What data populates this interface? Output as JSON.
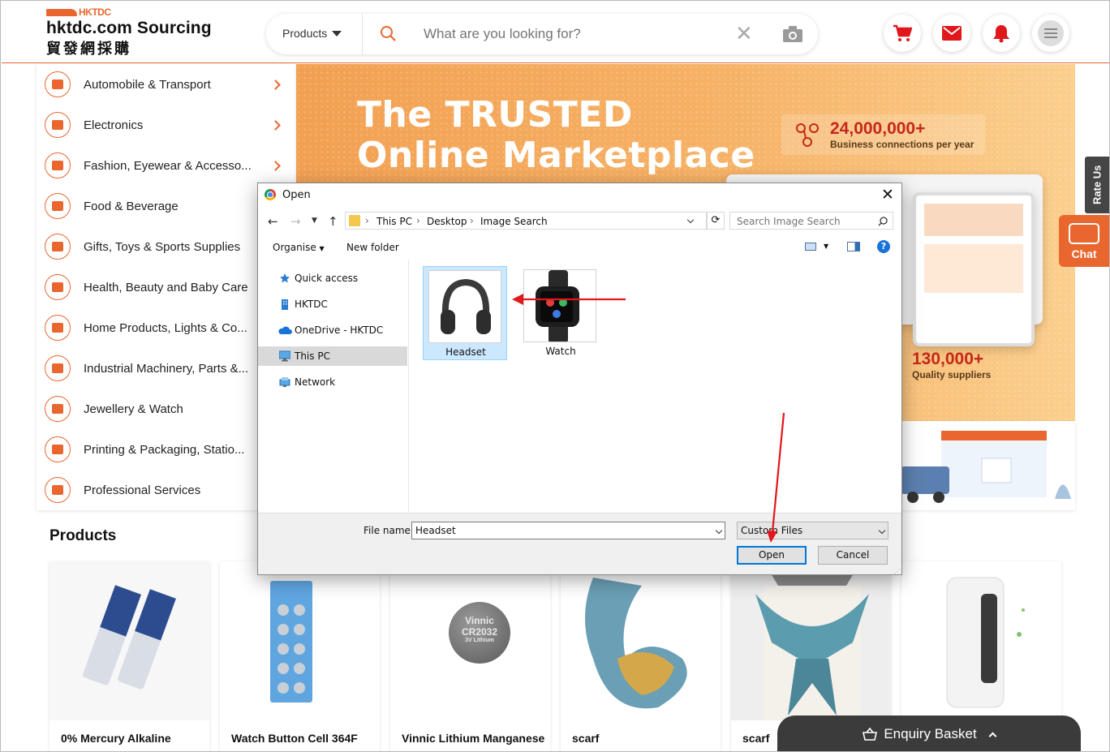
{
  "header": {
    "logo_top": "HKTDC",
    "logo_main": "hktdc.com Sourcing",
    "logo_cn": "貿發網採購",
    "search_category": "Products",
    "search_placeholder": "What are you looking for?",
    "icons": [
      "cart-icon",
      "mail-icon",
      "bell-icon",
      "menu-icon"
    ]
  },
  "sidebar": {
    "items": [
      {
        "label": "Automobile & Transport",
        "chevron": true
      },
      {
        "label": "Electronics",
        "chevron": true
      },
      {
        "label": "Fashion, Eyewear & Accesso...",
        "chevron": true
      },
      {
        "label": "Food & Beverage",
        "chevron": false
      },
      {
        "label": "Gifts, Toys & Sports Supplies",
        "chevron": false
      },
      {
        "label": "Health, Beauty and Baby Care",
        "chevron": false
      },
      {
        "label": "Home Products, Lights & Co...",
        "chevron": false
      },
      {
        "label": "Industrial Machinery, Parts &...",
        "chevron": false
      },
      {
        "label": "Jewellery & Watch",
        "chevron": false
      },
      {
        "label": "Printing & Packaging, Statio...",
        "chevron": false
      },
      {
        "label": "Professional Services",
        "chevron": false
      }
    ]
  },
  "banner": {
    "headline_1": "The TRUSTED",
    "headline_2": "Online Marketplace",
    "stat_1_value": "24,000,000+",
    "stat_1_label": "Business connections per year",
    "stat_2_value": "130,000+",
    "stat_2_label": "Quality suppliers"
  },
  "side_tabs": {
    "rate_us": "Rate Us",
    "chat": "Chat"
  },
  "products": {
    "title": "Products",
    "items": [
      {
        "name": "0% Mercury Alkaline"
      },
      {
        "name": "Watch Button Cell 364F"
      },
      {
        "name": "Vinnic Lithium Manganese"
      },
      {
        "name": "scarf"
      },
      {
        "name": "scarf"
      },
      {
        "name": ""
      }
    ],
    "battery_label_1": "Vinnic",
    "battery_label_2": "CR2032",
    "battery_label_3": "3V Lithium"
  },
  "basket": {
    "label": "Enquiry Basket"
  },
  "dialog": {
    "title": "Open",
    "path": [
      "This PC",
      "Desktop",
      "Image Search"
    ],
    "search_placeholder": "Search Image Search",
    "organise": "Organise",
    "new_folder": "New folder",
    "nav": [
      {
        "label": "Quick access",
        "icon": "star-icon"
      },
      {
        "label": "HKTDC",
        "icon": "building-icon"
      },
      {
        "label": "OneDrive - HKTDC",
        "icon": "cloud-icon"
      },
      {
        "label": "This PC",
        "icon": "computer-icon",
        "selected": true
      },
      {
        "label": "Network",
        "icon": "network-icon"
      }
    ],
    "files": [
      {
        "label": "Headset",
        "selected": true
      },
      {
        "label": "Watch",
        "selected": false
      }
    ],
    "file_name_label": "File name:",
    "file_name_value": "Headset",
    "file_type": "Custom Files",
    "open_button": "Open",
    "cancel_button": "Cancel"
  },
  "colors": {
    "accent": "#e9672f",
    "annotation": "#e0171b",
    "selection": "#cce8ff"
  }
}
